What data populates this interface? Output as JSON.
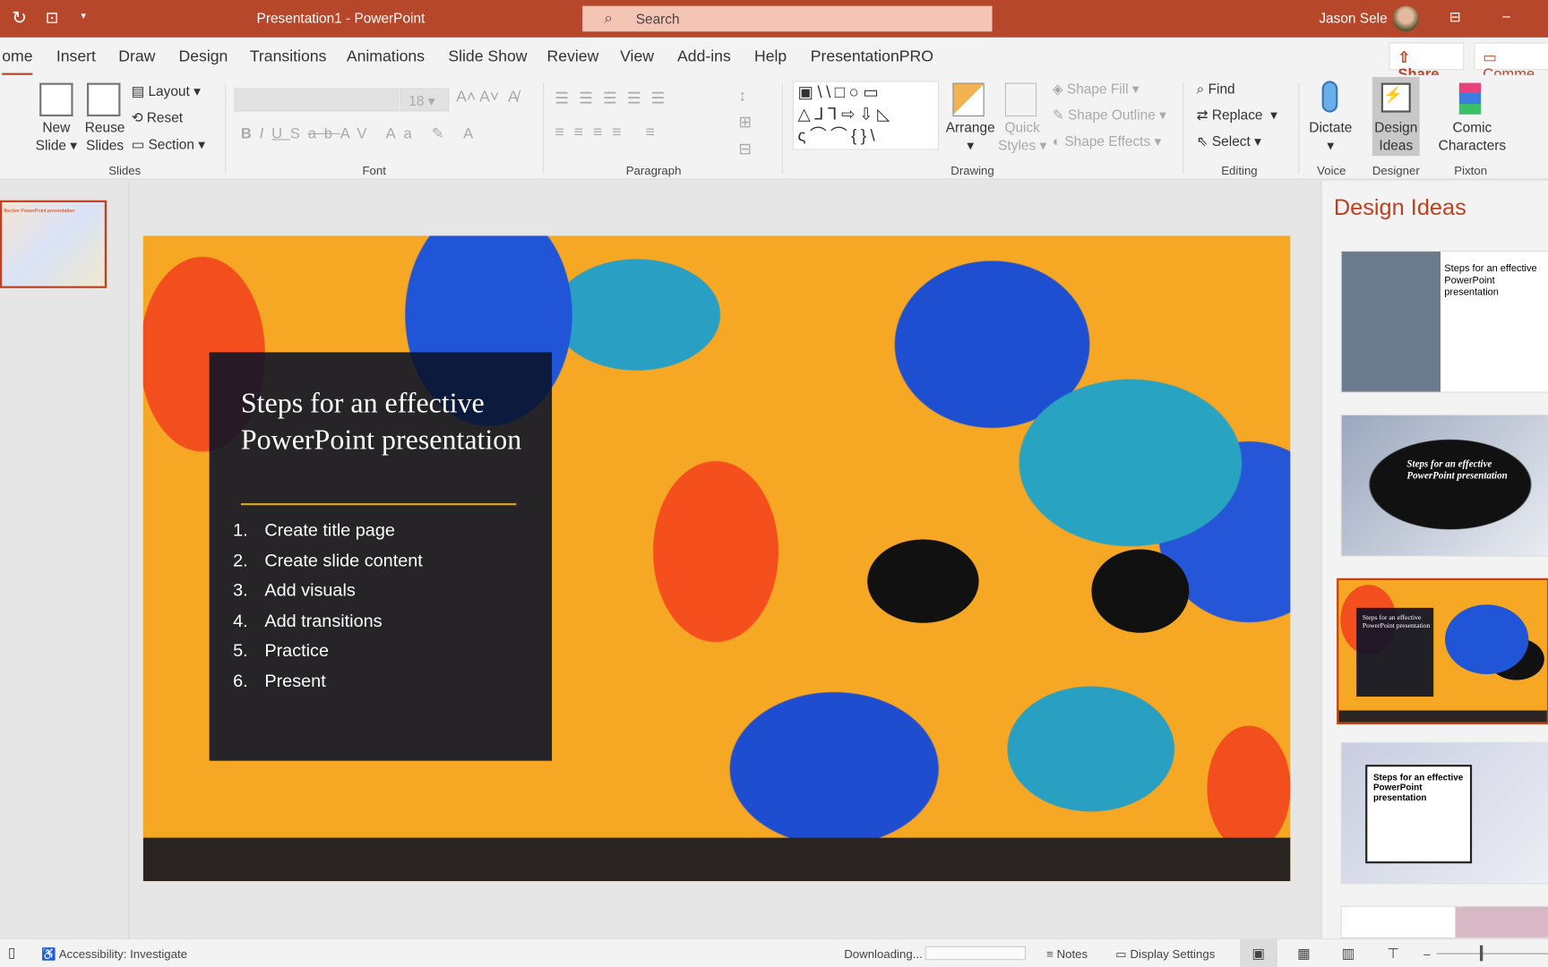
{
  "titlebar": {
    "title": "Presentation1  -  PowerPoint",
    "search_placeholder": "Search",
    "user": "Jason Sele"
  },
  "tabs": [
    "ome",
    "Insert",
    "Draw",
    "Design",
    "Transitions",
    "Animations",
    "Slide Show",
    "Review",
    "View",
    "Add-ins",
    "Help",
    "PresentationPRO"
  ],
  "share_label": "Share",
  "comments_label": "Comme",
  "ribbon": {
    "slides": {
      "new_slide": [
        "New",
        "Slide"
      ],
      "reuse_slides": [
        "Reuse",
        "Slides"
      ],
      "layout": "Layout",
      "reset": "Reset",
      "section": "Section",
      "group": "Slides"
    },
    "font": {
      "size": "18",
      "group": "Font"
    },
    "paragraph": {
      "group": "Paragraph"
    },
    "drawing": {
      "arrange": "Arrange",
      "quick_styles": [
        "Quick",
        "Styles"
      ],
      "shape_fill": "Shape Fill",
      "shape_outline": "Shape Outline",
      "shape_effects": "Shape Effects",
      "group": "Drawing"
    },
    "editing": {
      "find": "Find",
      "replace": "Replace",
      "select": "Select",
      "group": "Editing"
    },
    "voice": {
      "dictate": "Dictate",
      "group": "Voice"
    },
    "designer": {
      "design_ideas": [
        "Design",
        "Ideas"
      ],
      "group": "Designer"
    },
    "pixton": {
      "comic": [
        "Comic",
        "Characters"
      ],
      "group": "Pixton"
    }
  },
  "thumbnail_text": "ffective PowerPoint presentation",
  "slide": {
    "title": "Steps for an effective PowerPoint presentation",
    "items": [
      "Create title page",
      "Create slide content",
      "Add visuals",
      "Add transitions",
      "Practice",
      "Present"
    ],
    "numbers": [
      "1.",
      "2.",
      "3.",
      "4.",
      "5.",
      "6."
    ]
  },
  "design_ideas": {
    "heading": "Design Ideas",
    "title_short": "Steps for an effective PowerPoint presentation"
  },
  "status": {
    "accessibility": "Accessibility: Investigate",
    "downloading": "Downloading...",
    "notes": "Notes",
    "display_settings": "Display Settings"
  },
  "colors": {
    "accent": "#b7472a",
    "title_bar": "#b7472a",
    "design_heading": "#c43e1c"
  }
}
